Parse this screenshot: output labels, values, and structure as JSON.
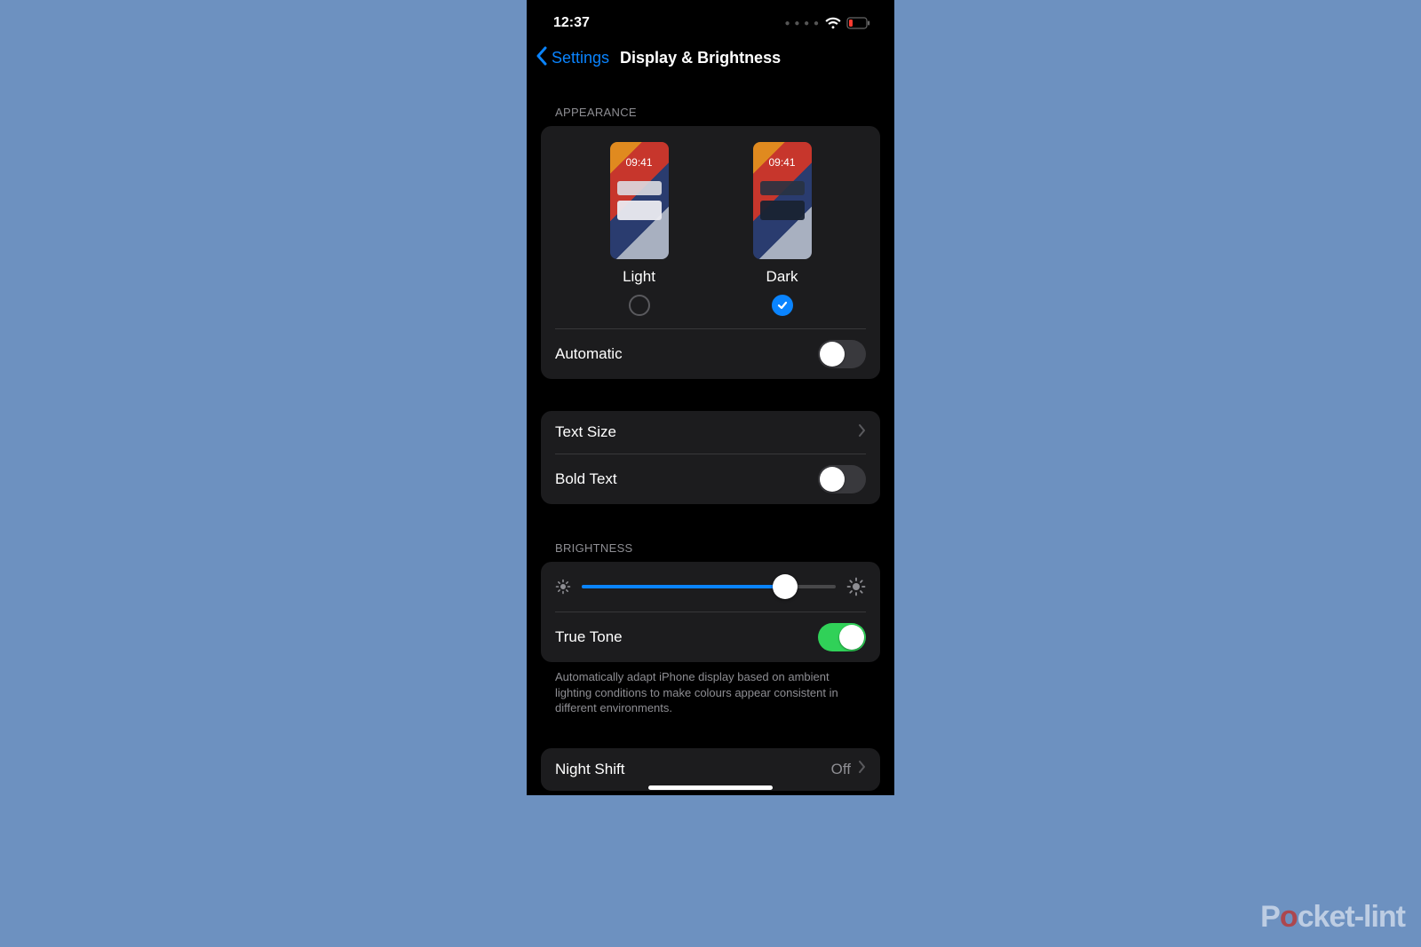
{
  "status": {
    "time": "12:37"
  },
  "nav": {
    "back": "Settings",
    "title": "Display & Brightness"
  },
  "sections": {
    "appearance_header": "APPEARANCE",
    "brightness_header": "BRIGHTNESS"
  },
  "appearance": {
    "light": {
      "label": "Light",
      "preview_time": "09:41",
      "selected": false
    },
    "dark": {
      "label": "Dark",
      "preview_time": "09:41",
      "selected": true
    },
    "automatic": {
      "label": "Automatic",
      "on": false
    }
  },
  "text": {
    "text_size": {
      "label": "Text Size"
    },
    "bold_text": {
      "label": "Bold Text",
      "on": false
    }
  },
  "brightness": {
    "value_percent": 80,
    "true_tone": {
      "label": "True Tone",
      "on": true
    },
    "footer": "Automatically adapt iPhone display based on ambient lighting conditions to make colours appear consistent in different environments."
  },
  "night_shift": {
    "label": "Night Shift",
    "value": "Off"
  },
  "watermark": {
    "prefix": "P",
    "o": "o",
    "suffix": "cket-lint"
  }
}
